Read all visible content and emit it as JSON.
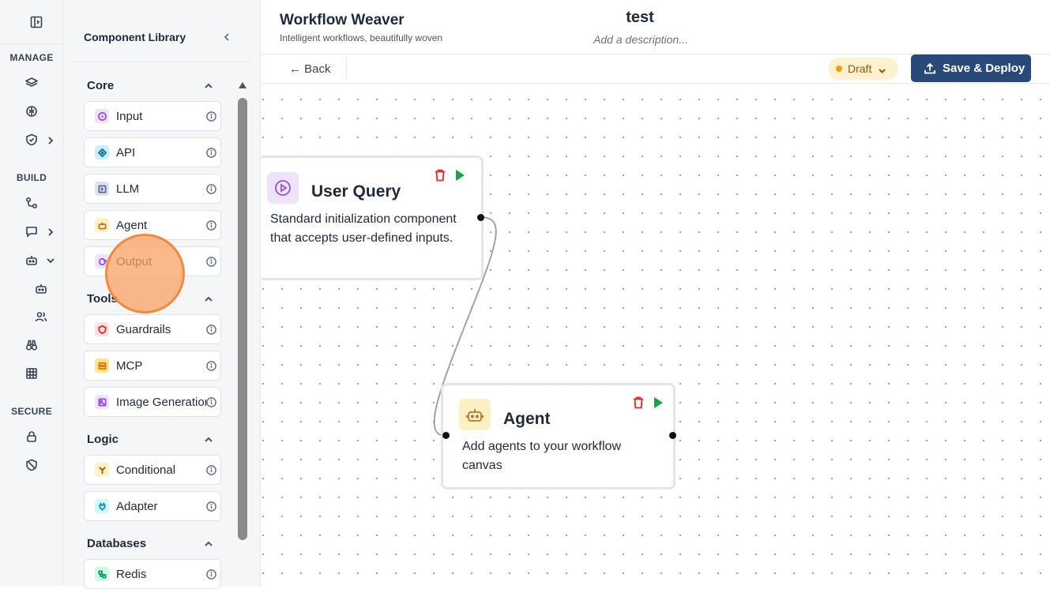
{
  "rail": {
    "sections": [
      "MANAGE",
      "BUILD",
      "SECURE"
    ],
    "icons": [
      "sidebar-toggle-icon",
      "layers-icon",
      "brain-icon",
      "shield-icon",
      "workflow-icon",
      "chat-icon",
      "bot-icon",
      "bot-small-icon",
      "users-icon",
      "binoculars-icon",
      "table-icon",
      "lock-icon",
      "shield-off-icon"
    ]
  },
  "library": {
    "title": "Component Library",
    "groups": [
      {
        "name": "Core",
        "items": [
          {
            "label": "Input",
            "icon": "play-circle-icon",
            "color": "#ede4fb",
            "stroke": "#9a4fe0"
          },
          {
            "label": "API",
            "icon": "api-icon",
            "color": "#cdeef6",
            "stroke": "#0e7490"
          },
          {
            "label": "LLM",
            "icon": "llm-icon",
            "color": "#dbe3f2",
            "stroke": "#5b6b8a"
          },
          {
            "label": "Agent",
            "icon": "bot-icon",
            "color": "#fdf0c4",
            "stroke": "#b7791f"
          },
          {
            "label": "Output",
            "icon": "output-icon",
            "color": "#ede4fb",
            "stroke": "#9a4fe0"
          }
        ]
      },
      {
        "name": "Tools",
        "items": [
          {
            "label": "Guardrails",
            "icon": "shield-icon",
            "color": "#fde2e2",
            "stroke": "#dc2626"
          },
          {
            "label": "MCP",
            "icon": "server-icon",
            "color": "#fde68a",
            "stroke": "#d97706"
          },
          {
            "label": "Image Generation",
            "icon": "image-icon",
            "color": "#ede4fb",
            "stroke": "#9a4fe0"
          }
        ]
      },
      {
        "name": "Logic",
        "items": [
          {
            "label": "Conditional",
            "icon": "branch-icon",
            "color": "#fef3c7",
            "stroke": "#b45309"
          },
          {
            "label": "Adapter",
            "icon": "plug-icon",
            "color": "#cffafe",
            "stroke": "#0891b2"
          }
        ]
      },
      {
        "name": "Databases",
        "items": [
          {
            "label": "Redis",
            "icon": "database-icon",
            "color": "#d1fae5",
            "stroke": "#059669"
          }
        ]
      }
    ]
  },
  "header": {
    "app_title": "Workflow Weaver",
    "app_subtitle": "Intelligent workflows, beautifully woven",
    "workflow_name": "test",
    "workflow_description": "Add a description..."
  },
  "toolbar": {
    "back_label": "← Back",
    "status_label": "Draft",
    "deploy_label": "Save & Deploy",
    "status_color": "#f59e0b",
    "deploy_color": "#284a78"
  },
  "canvas": {
    "nodes": [
      {
        "title": "User Query",
        "description": "Standard initialization component that accepts user-defined inputs.",
        "icon": "play-circle-icon"
      },
      {
        "title": "Agent",
        "description": "Add agents to your workflow canvas",
        "icon": "bot-icon"
      }
    ]
  }
}
